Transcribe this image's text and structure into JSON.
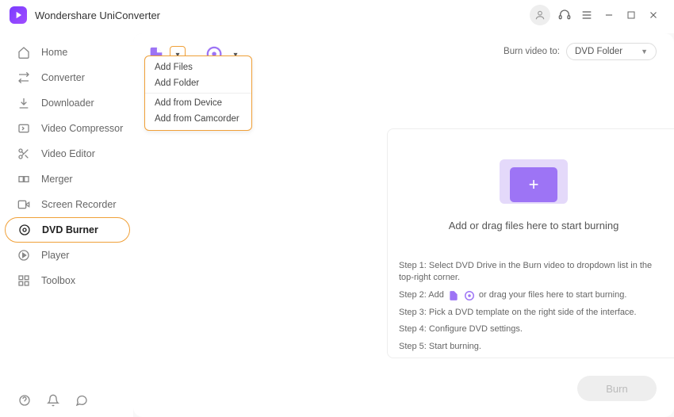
{
  "app": {
    "title": "Wondershare UniConverter"
  },
  "titlebar_icons": {
    "user": "user",
    "headset": "support",
    "menu": "menu",
    "min": "minimize",
    "max": "maximize",
    "close": "close"
  },
  "sidebar": {
    "items": [
      {
        "label": "Home",
        "icon": "home"
      },
      {
        "label": "Converter",
        "icon": "converter"
      },
      {
        "label": "Downloader",
        "icon": "download"
      },
      {
        "label": "Video Compressor",
        "icon": "compress"
      },
      {
        "label": "Video Editor",
        "icon": "scissors"
      },
      {
        "label": "Merger",
        "icon": "merge"
      },
      {
        "label": "Screen Recorder",
        "icon": "record"
      },
      {
        "label": "DVD Burner",
        "icon": "disc",
        "active": true
      },
      {
        "label": "Player",
        "icon": "play"
      },
      {
        "label": "Toolbox",
        "icon": "grid"
      }
    ]
  },
  "burn_to": {
    "label": "Burn video to:",
    "value": "DVD Folder"
  },
  "dropdown": {
    "items_a": [
      "Add Files",
      "Add Folder"
    ],
    "items_b": [
      "Add from Device",
      "Add from Camcorder"
    ]
  },
  "drop": {
    "text": "Add or drag files here to start burning"
  },
  "steps": {
    "s1": "Step 1: Select DVD Drive in the Burn video to dropdown list in the top-right corner.",
    "s2a": "Step 2: Add",
    "s2b": "or drag your files here to start burning.",
    "s3": "Step 3: Pick a DVD template on the right side of the interface.",
    "s4": "Step 4: Configure DVD settings.",
    "s5": "Step 5: Start burning."
  },
  "burn_button": "Burn",
  "colors": {
    "accent": "#9d74f5",
    "highlight_border": "#f0a038"
  }
}
